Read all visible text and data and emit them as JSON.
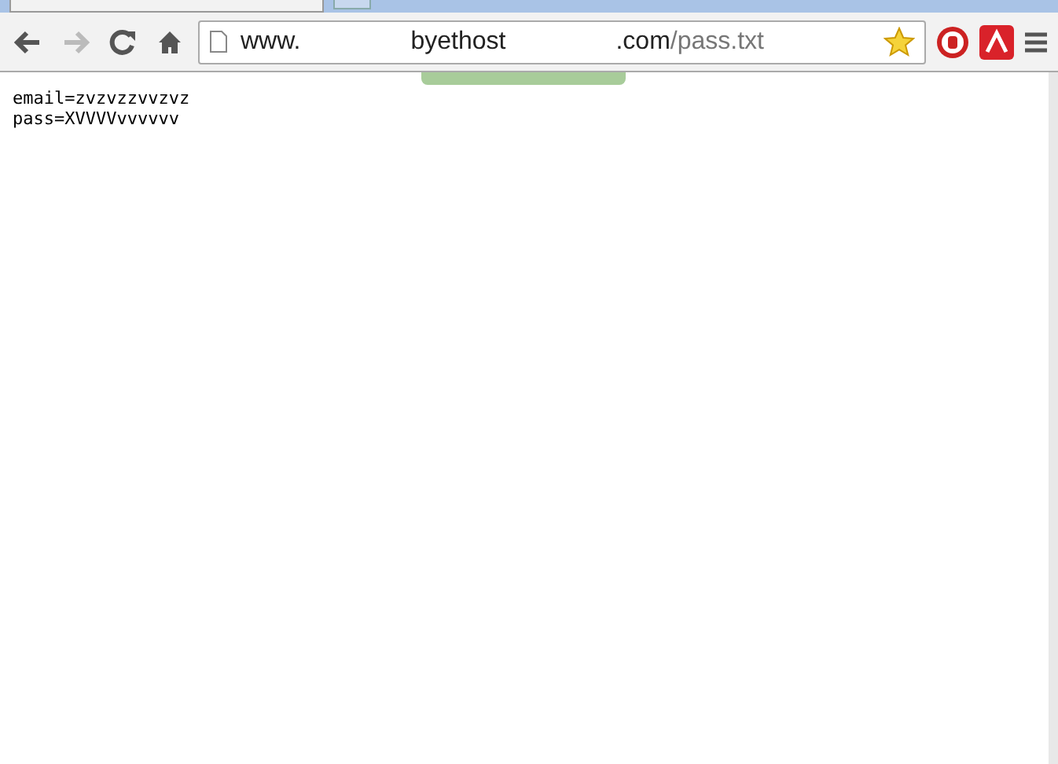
{
  "address_bar": {
    "segments": [
      {
        "text": "www.",
        "kind": "host"
      },
      {
        "text": "byethost",
        "kind": "host"
      },
      {
        "text": ".com",
        "kind": "host"
      },
      {
        "text": "/pass.txt",
        "kind": "path"
      }
    ]
  },
  "toolbar": {
    "forward_disabled": true,
    "bookmarked": true
  },
  "content": {
    "lines": [
      "email=zvzvzzvvzvz",
      "pass=XVVVVvvvvvv"
    ]
  }
}
